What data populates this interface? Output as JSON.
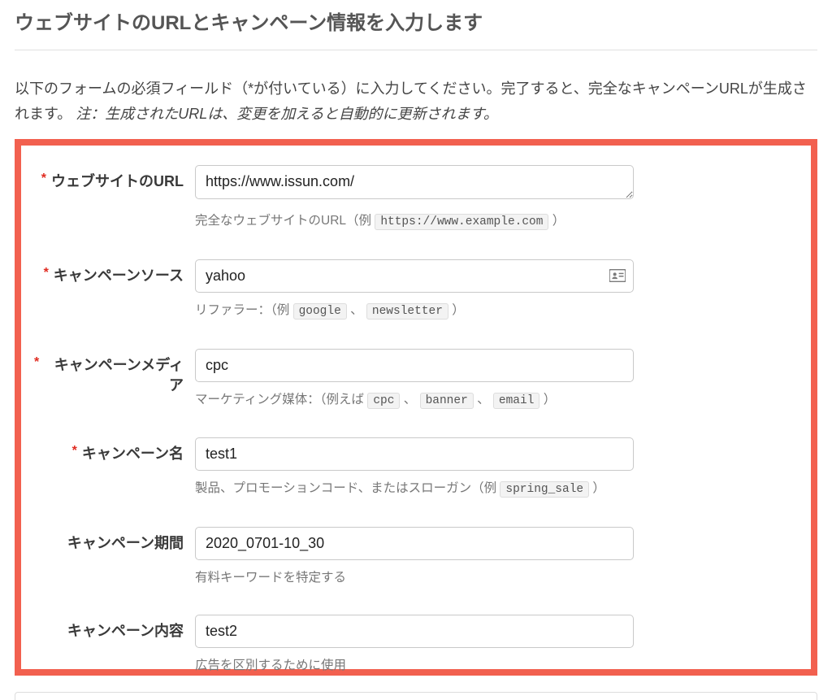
{
  "title": "ウェブサイトのURLとキャンペーン情報を入力します",
  "instruction_main": "以下のフォームの必須フィールド（*が付いている）に入力してください。完了すると、完全なキャンペーンURLが生成されます。",
  "instruction_note": "注：生成されたURLは、変更を加えると自動的に更新されます。",
  "fields": {
    "url": {
      "label": "ウェブサイトのURL",
      "required_mark": "*",
      "value": "https://www.issun.com/",
      "help_pre": "完全なウェブサイトのURL（例 ",
      "help_code1": "https://www.example.com",
      "help_post": " ）"
    },
    "source": {
      "label": "キャンペーンソース",
      "required_mark": "*",
      "value": "yahoo",
      "help_pre": "リファラー：（例 ",
      "help_code1": "google",
      "help_sep1": " 、 ",
      "help_code2": "newsletter",
      "help_post": " ）"
    },
    "medium": {
      "label": "キャンペーンメディア",
      "required_mark": "*",
      "value": "cpc",
      "help_pre": "マーケティング媒体：（例えば ",
      "help_code1": "cpc",
      "help_sep1": " 、 ",
      "help_code2": "banner",
      "help_sep2": " 、 ",
      "help_code3": "email",
      "help_post": " ）"
    },
    "name": {
      "label": "キャンペーン名",
      "required_mark": "*",
      "value": "test1",
      "help_pre": "製品、プロモーションコード、またはスローガン（例 ",
      "help_code1": "spring_sale",
      "help_post": " ）"
    },
    "term": {
      "label": "キャンペーン期間",
      "value": "2020_0701-10_30",
      "help_pre": "有料キーワードを特定する"
    },
    "content": {
      "label": "キャンペーン内容",
      "value": "test2",
      "help_pre": "広告を区別するために使用"
    }
  }
}
